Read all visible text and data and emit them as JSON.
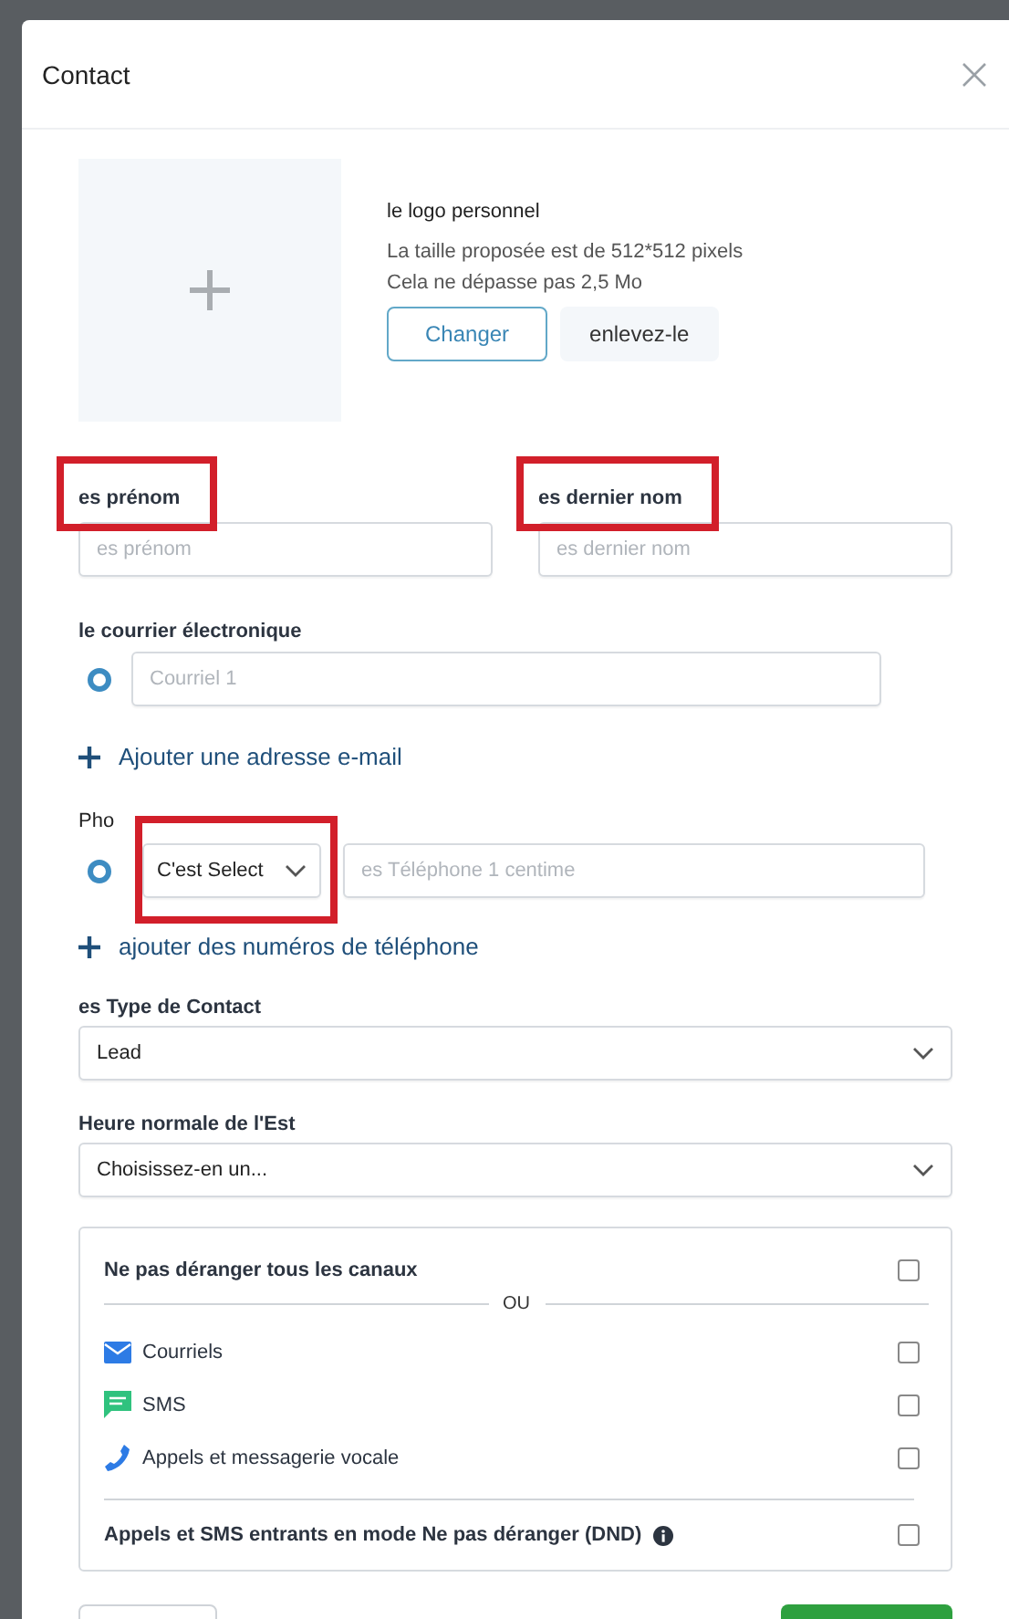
{
  "dialog": {
    "title": "Contact"
  },
  "logo": {
    "title": "le logo personnel",
    "hints": [
      "La taille proposée est de 512*512 pixels",
      "Cela ne dépasse pas 2,5 Mo"
    ],
    "buttons": [
      {
        "label": "Changer",
        "kind": "outline"
      },
      {
        "label": "enlevez-le",
        "kind": "plain"
      }
    ]
  },
  "name_fields": [
    {
      "label": "es prénom",
      "placeholder": "es prénom",
      "highlighted": true
    },
    {
      "label": "es dernier nom",
      "placeholder": "es dernier nom",
      "highlighted": true
    }
  ],
  "email": {
    "label": "le courrier électronique",
    "entries": [
      {
        "placeholder": "Courriel 1",
        "selected": true
      }
    ],
    "add_link": "Ajouter une adresse e-mail"
  },
  "phone": {
    "label": "Pho",
    "entries": [
      {
        "type_select": "C'est Select",
        "type_highlighted": true,
        "placeholder": "es Téléphone 1 centime",
        "selected": true
      }
    ],
    "add_link": "ajouter des numéros de téléphone"
  },
  "contact_type": {
    "label": "es Type de Contact",
    "value": "Lead"
  },
  "timezone": {
    "label": "Heure normale de l'Est",
    "value": "Choisissez-en un..."
  },
  "dnd": {
    "all": {
      "label": "Ne pas déranger tous les canaux",
      "checked": false
    },
    "separator": "OU",
    "channels": [
      {
        "label": "Courriels",
        "kind": "email",
        "checked": false
      },
      {
        "label": "SMS",
        "kind": "sms",
        "checked": false
      },
      {
        "label": "Appels et messagerie vocale",
        "kind": "call",
        "checked": false
      }
    ],
    "inbound": {
      "label": "Appels et SMS entrants en mode Ne pas déranger (DND)",
      "checked": false
    }
  },
  "footer": {
    "buttons": [
      {
        "kind": "cancel"
      },
      {
        "kind": "save"
      }
    ]
  }
}
